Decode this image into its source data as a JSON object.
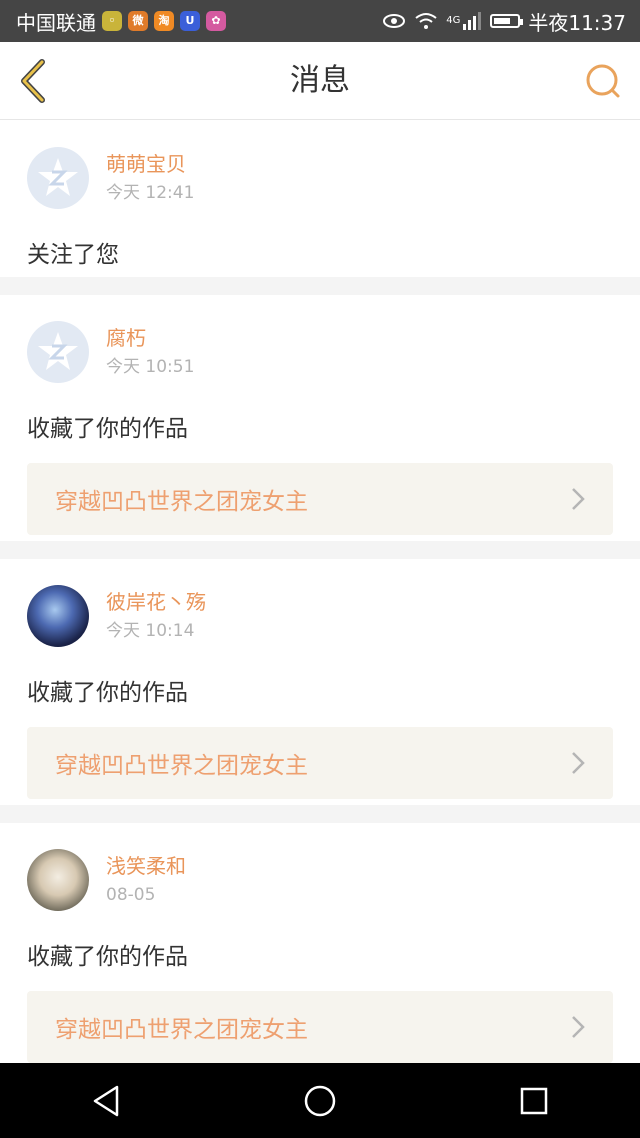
{
  "status_bar": {
    "carrier": "中国联通",
    "network": "4G",
    "time": "半夜11:37",
    "app_icons": [
      {
        "name": "message-app-icon",
        "color": "#c9b43a",
        "glyph": "◦"
      },
      {
        "name": "weibo-app-icon",
        "color": "#e07b2a",
        "glyph": "微"
      },
      {
        "name": "taobao-app-icon",
        "color": "#f08a24",
        "glyph": "淘"
      },
      {
        "name": "uc-app-icon",
        "color": "#3b5fd9",
        "glyph": "U"
      },
      {
        "name": "flower-app-icon",
        "color": "#d45aa0",
        "glyph": "✿"
      }
    ]
  },
  "header": {
    "title": "消息",
    "accent_color": "#e9a35c"
  },
  "messages": [
    {
      "username": "萌萌宝贝",
      "time": "今天 12:41",
      "action": "关注了您"
    },
    {
      "username": "腐朽",
      "time": "今天 10:51",
      "action": "收藏了你的作品",
      "work_title": "穿越凹凸世界之团宠女主"
    },
    {
      "username": "彼岸花丶殇",
      "time": "今天 10:14",
      "action": "收藏了你的作品",
      "work_title": "穿越凹凸世界之团宠女主"
    },
    {
      "username": "浅笑柔和",
      "time": "08-05",
      "action": "收藏了你的作品",
      "work_title": "穿越凹凸世界之团宠女主"
    }
  ]
}
